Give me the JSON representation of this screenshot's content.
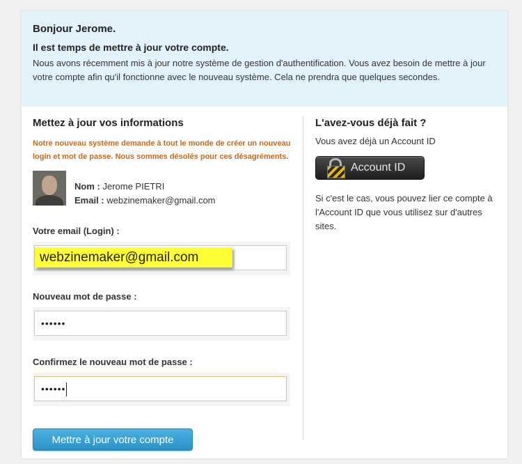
{
  "banner": {
    "greeting": "Bonjour Jerome.",
    "title": "Il est temps de mettre à jour votre compte.",
    "text": "Nous avons récemment mis à jour notre système de gestion d'authentification. Vous avez besoin de mettre à jour votre compte afin qu'il fonctionne avec le nouveau système. Cela ne prendra que quelques secondes."
  },
  "form": {
    "heading": "Mettez à jour vos informations",
    "notice": "Notre nouveau système demande à tout le monde de créer un nouveau login et mot de passe. Nous sommes désolés pour ces désagréments.",
    "user": {
      "name_label": "Nom :",
      "name_value": "Jerome PIETRI",
      "email_label": "Email :",
      "email_value": "webzinemaker@gmail.com"
    },
    "email_label": "Votre email (Login) :",
    "email_value": "webzinemaker@gmail.com",
    "new_password_label": "Nouveau mot de passe :",
    "new_password_mask": "••••••",
    "confirm_password_label": "Confirmez le nouveau mot de passe :",
    "confirm_password_mask": "••••••",
    "submit_label": "Mettre à jour votre compte"
  },
  "aside": {
    "heading": "L'avez-vous déjà fait ?",
    "subtext": "Vous avez déjà un Account ID",
    "account_button_label": "Account ID",
    "account_button_icon": "lock-icon",
    "description": "Si c'est le cas, vous pouvez lier ce compte à l'Account ID que vous utilisez sur d'autres sites."
  },
  "colors": {
    "banner_bg": "#e1f2fa",
    "notice": "#c8691a",
    "submit": "#2a92c8",
    "highlight": "#ffff33"
  }
}
